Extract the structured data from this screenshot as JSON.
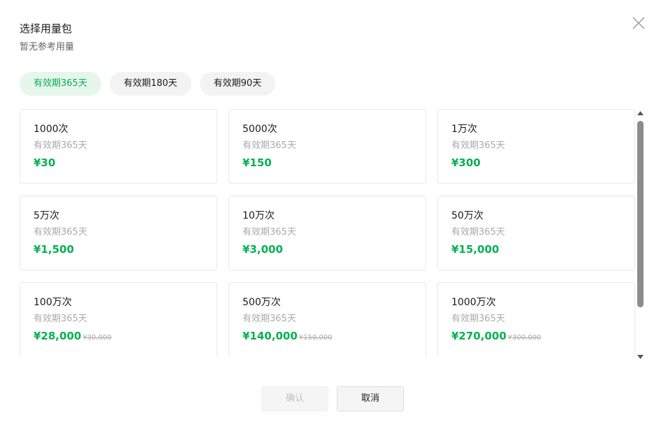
{
  "dialog": {
    "title": "选择用量包",
    "subtitle": "暂无参考用量"
  },
  "tabs": [
    {
      "label": "有效期365天",
      "active": true
    },
    {
      "label": "有效期180天",
      "active": false
    },
    {
      "label": "有效期90天",
      "active": false
    }
  ],
  "packages": [
    {
      "name": "1000次",
      "validity": "有效期365天",
      "price": "¥30",
      "original_price": ""
    },
    {
      "name": "5000次",
      "validity": "有效期365天",
      "price": "¥150",
      "original_price": ""
    },
    {
      "name": "1万次",
      "validity": "有效期365天",
      "price": "¥300",
      "original_price": ""
    },
    {
      "name": "5万次",
      "validity": "有效期365天",
      "price": "¥1,500",
      "original_price": ""
    },
    {
      "name": "10万次",
      "validity": "有效期365天",
      "price": "¥3,000",
      "original_price": ""
    },
    {
      "name": "50万次",
      "validity": "有效期365天",
      "price": "¥15,000",
      "original_price": ""
    },
    {
      "name": "100万次",
      "validity": "有效期365天",
      "price": "¥28,000",
      "original_price": "¥30,000"
    },
    {
      "name": "500万次",
      "validity": "有效期365天",
      "price": "¥140,000",
      "original_price": "¥150,000"
    },
    {
      "name": "1000万次",
      "validity": "有效期365天",
      "price": "¥270,000",
      "original_price": "¥300,000"
    }
  ],
  "footer": {
    "confirm_label": "确认",
    "confirm_disabled": true,
    "cancel_label": "取消"
  },
  "colors": {
    "accent": "#07b053",
    "active_tab_bg": "#e6f6ec",
    "muted_text": "#aaaaaa"
  },
  "icons": {
    "close": "close-icon",
    "scroll_up": "triangle-up-icon",
    "scroll_down": "triangle-down-icon"
  }
}
